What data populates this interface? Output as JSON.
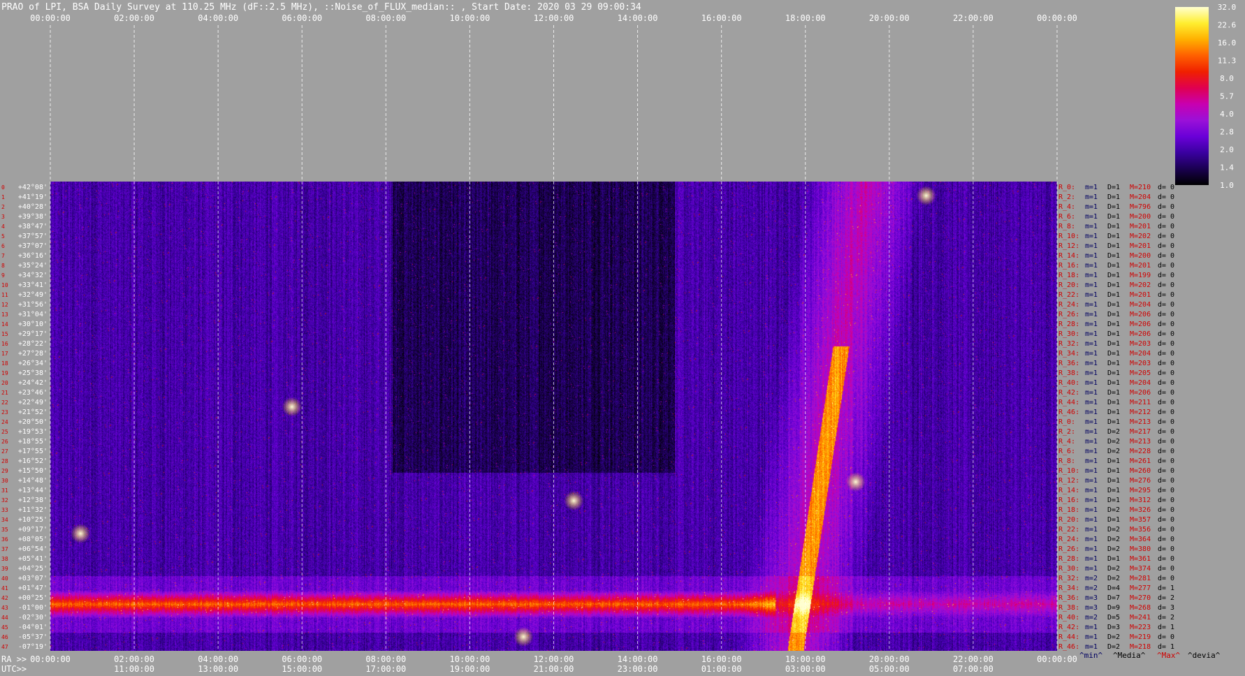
{
  "chart_data": {
    "type": "heatmap",
    "title": "PRAO of LPI, BSA Daily Survey at 110.25 MHz (dF::2.5 MHz), ::Noise_of_FLUX_median:: , Start Date: 2020 03 29 09:00:34",
    "top_ticks": [
      "00:00:00",
      "02:00:00",
      "04:00:00",
      "06:00:00",
      "08:00:00",
      "10:00:00",
      "12:00:00",
      "14:00:00",
      "16:00:00",
      "18:00:00",
      "20:00:00",
      "22:00:00",
      "00:00:00"
    ],
    "ra_prefix": "RA >>",
    "ra_ticks": [
      "00:00:00",
      "02:00:00",
      "04:00:00",
      "06:00:00",
      "08:00:00",
      "10:00:00",
      "12:00:00",
      "14:00:00",
      "16:00:00",
      "18:00:00",
      "20:00:00",
      "22:00:00",
      "00:00:00"
    ],
    "utc_prefix": "UTC>>",
    "utc_ticks": [
      "11:00:00",
      "13:00:00",
      "15:00:00",
      "17:00:00",
      "19:00:00",
      "21:00:00",
      "23:00:00",
      "01:00:00",
      "03:00:00",
      "05:00:00",
      "07:00:00"
    ],
    "dec_labels": [
      "+42°08'",
      "+41°19'",
      "+40°28'",
      "+39°38'",
      "+38°47'",
      "+37°57'",
      "+37°07'",
      "+36°16'",
      "+35°24'",
      "+34°32'",
      "+33°41'",
      "+32°49'",
      "+31°56'",
      "+31°04'",
      "+30°10'",
      "+29°17'",
      "+28°22'",
      "+27°28'",
      "+26°34'",
      "+25°38'",
      "+24°42'",
      "+23°46'",
      "+22°49'",
      "+21°52'",
      "+20°50'",
      "+19°53'",
      "+18°55'",
      "+17°55'",
      "+16°52'",
      "+15°50'",
      "+14°48'",
      "+13°44'",
      "+12°38'",
      "+11°32'",
      "+10°25'",
      "+09°17'",
      "+08°05'",
      "+06°54'",
      "+05°41'",
      "+04°25'",
      "+03°07'",
      "+01°47'",
      "+00°25'",
      "-01°00'",
      "-02°30'",
      "-04°01'",
      "-05°37'",
      "-07°19'"
    ],
    "beam_numbers": [
      "0",
      "1",
      "2",
      "3",
      "4",
      "5",
      "6",
      "7",
      "8",
      "9",
      "10",
      "11",
      "12",
      "13",
      "14",
      "15",
      "16",
      "17",
      "18",
      "19",
      "20",
      "21",
      "22",
      "23",
      "24",
      "25",
      "26",
      "27",
      "28",
      "29",
      "30",
      "31",
      "32",
      "33",
      "34",
      "35",
      "36",
      "37",
      "38",
      "39",
      "40",
      "41",
      "42",
      "43",
      "44",
      "45",
      "46",
      "47"
    ],
    "stats_rows": [
      {
        "r": "R_0:",
        "m": "m=1",
        "d": "D=1",
        "mx": "M=210",
        "dv": "d= 0"
      },
      {
        "r": "R_2:",
        "m": "m=1",
        "d": "D=1",
        "mx": "M=204",
        "dv": "d= 0"
      },
      {
        "r": "R_4:",
        "m": "m=1",
        "d": "D=1",
        "mx": "M=796",
        "dv": "d= 0"
      },
      {
        "r": "R_6:",
        "m": "m=1",
        "d": "D=1",
        "mx": "M=200",
        "dv": "d= 0"
      },
      {
        "r": "R_8:",
        "m": "m=1",
        "d": "D=1",
        "mx": "M=201",
        "dv": "d= 0"
      },
      {
        "r": "R_10:",
        "m": "m=1",
        "d": "D=1",
        "mx": "M=202",
        "dv": "d= 0"
      },
      {
        "r": "R_12:",
        "m": "m=1",
        "d": "D=1",
        "mx": "M=201",
        "dv": "d= 0"
      },
      {
        "r": "R_14:",
        "m": "m=1",
        "d": "D=1",
        "mx": "M=200",
        "dv": "d= 0"
      },
      {
        "r": "R_16:",
        "m": "m=1",
        "d": "D=1",
        "mx": "M=201",
        "dv": "d= 0"
      },
      {
        "r": "R_18:",
        "m": "m=1",
        "d": "D=1",
        "mx": "M=199",
        "dv": "d= 0"
      },
      {
        "r": "R_20:",
        "m": "m=1",
        "d": "D=1",
        "mx": "M=202",
        "dv": "d= 0"
      },
      {
        "r": "R_22:",
        "m": "m=1",
        "d": "D=1",
        "mx": "M=201",
        "dv": "d= 0"
      },
      {
        "r": "R_24:",
        "m": "m=1",
        "d": "D=1",
        "mx": "M=204",
        "dv": "d= 0"
      },
      {
        "r": "R_26:",
        "m": "m=1",
        "d": "D=1",
        "mx": "M=206",
        "dv": "d= 0"
      },
      {
        "r": "R_28:",
        "m": "m=1",
        "d": "D=1",
        "mx": "M=206",
        "dv": "d= 0"
      },
      {
        "r": "R_30:",
        "m": "m=1",
        "d": "D=1",
        "mx": "M=206",
        "dv": "d= 0"
      },
      {
        "r": "R_32:",
        "m": "m=1",
        "d": "D=1",
        "mx": "M=203",
        "dv": "d= 0"
      },
      {
        "r": "R_34:",
        "m": "m=1",
        "d": "D=1",
        "mx": "M=204",
        "dv": "d= 0"
      },
      {
        "r": "R_36:",
        "m": "m=1",
        "d": "D=1",
        "mx": "M=203",
        "dv": "d= 0"
      },
      {
        "r": "R_38:",
        "m": "m=1",
        "d": "D=1",
        "mx": "M=205",
        "dv": "d= 0"
      },
      {
        "r": "R_40:",
        "m": "m=1",
        "d": "D=1",
        "mx": "M=204",
        "dv": "d= 0"
      },
      {
        "r": "R_42:",
        "m": "m=1",
        "d": "D=1",
        "mx": "M=206",
        "dv": "d= 0"
      },
      {
        "r": "R_44:",
        "m": "m=1",
        "d": "D=1",
        "mx": "M=211",
        "dv": "d= 0"
      },
      {
        "r": "R_46:",
        "m": "m=1",
        "d": "D=1",
        "mx": "M=212",
        "dv": "d= 0"
      },
      {
        "r": "R_0:",
        "m": "m=1",
        "d": "D=1",
        "mx": "M=213",
        "dv": "d= 0"
      },
      {
        "r": "R_2:",
        "m": "m=1",
        "d": "D=2",
        "mx": "M=217",
        "dv": "d= 0"
      },
      {
        "r": "R_4:",
        "m": "m=1",
        "d": "D=2",
        "mx": "M=213",
        "dv": "d= 0"
      },
      {
        "r": "R_6:",
        "m": "m=1",
        "d": "D=2",
        "mx": "M=228",
        "dv": "d= 0"
      },
      {
        "r": "R_8:",
        "m": "m=1",
        "d": "D=1",
        "mx": "M=261",
        "dv": "d= 0"
      },
      {
        "r": "R_10:",
        "m": "m=1",
        "d": "D=1",
        "mx": "M=260",
        "dv": "d= 0"
      },
      {
        "r": "R_12:",
        "m": "m=1",
        "d": "D=1",
        "mx": "M=276",
        "dv": "d= 0"
      },
      {
        "r": "R_14:",
        "m": "m=1",
        "d": "D=1",
        "mx": "M=295",
        "dv": "d= 0"
      },
      {
        "r": "R_16:",
        "m": "m=1",
        "d": "D=1",
        "mx": "M=312",
        "dv": "d= 0"
      },
      {
        "r": "R_18:",
        "m": "m=1",
        "d": "D=2",
        "mx": "M=326",
        "dv": "d= 0"
      },
      {
        "r": "R_20:",
        "m": "m=1",
        "d": "D=1",
        "mx": "M=357",
        "dv": "d= 0"
      },
      {
        "r": "R_22:",
        "m": "m=1",
        "d": "D=2",
        "mx": "M=356",
        "dv": "d= 0"
      },
      {
        "r": "R_24:",
        "m": "m=1",
        "d": "D=2",
        "mx": "M=364",
        "dv": "d= 0"
      },
      {
        "r": "R_26:",
        "m": "m=1",
        "d": "D=2",
        "mx": "M=380",
        "dv": "d= 0"
      },
      {
        "r": "R_28:",
        "m": "m=1",
        "d": "D=1",
        "mx": "M=361",
        "dv": "d= 0"
      },
      {
        "r": "R_30:",
        "m": "m=1",
        "d": "D=2",
        "mx": "M=374",
        "dv": "d= 0"
      },
      {
        "r": "R_32:",
        "m": "m=2",
        "d": "D=2",
        "mx": "M=281",
        "dv": "d= 0"
      },
      {
        "r": "R_34:",
        "m": "m=2",
        "d": "D=4",
        "mx": "M=277",
        "dv": "d= 1"
      },
      {
        "r": "R_36:",
        "m": "m=3",
        "d": "D=7",
        "mx": "M=270",
        "dv": "d= 2"
      },
      {
        "r": "R_38:",
        "m": "m=3",
        "d": "D=9",
        "mx": "M=268",
        "dv": "d= 3"
      },
      {
        "r": "R_40:",
        "m": "m=2",
        "d": "D=5",
        "mx": "M=241",
        "dv": "d= 2"
      },
      {
        "r": "R_42:",
        "m": "m=1",
        "d": "D=3",
        "mx": "M=223",
        "dv": "d= 1"
      },
      {
        "r": "R_44:",
        "m": "m=1",
        "d": "D=2",
        "mx": "M=219",
        "dv": "d= 0"
      },
      {
        "r": "R_46:",
        "m": "m=1",
        "d": "D=2",
        "mx": "M=218",
        "dv": "d= 1"
      }
    ],
    "stats_legend": [
      "^min^",
      "^Media^",
      "^Max^",
      "^devia^"
    ],
    "colorbar_ticks": [
      "32.0",
      "22.6",
      "16.0",
      "11.3",
      "8.0",
      "5.7",
      "4.0",
      "2.8",
      "2.0",
      "1.4",
      "1.0"
    ],
    "colors": {
      "background": "#a0a0a0",
      "tick_text": "#ffffff",
      "label_red": "#d00000",
      "label_navy": "#000060",
      "colormap": [
        "#000000",
        "#1a0050",
        "#3a00a0",
        "#6a00d8",
        "#9a10d8",
        "#c800b0",
        "#e00050",
        "#f02000",
        "#ff6000",
        "#ffb000",
        "#ffee30",
        "#ffffd0"
      ]
    }
  }
}
